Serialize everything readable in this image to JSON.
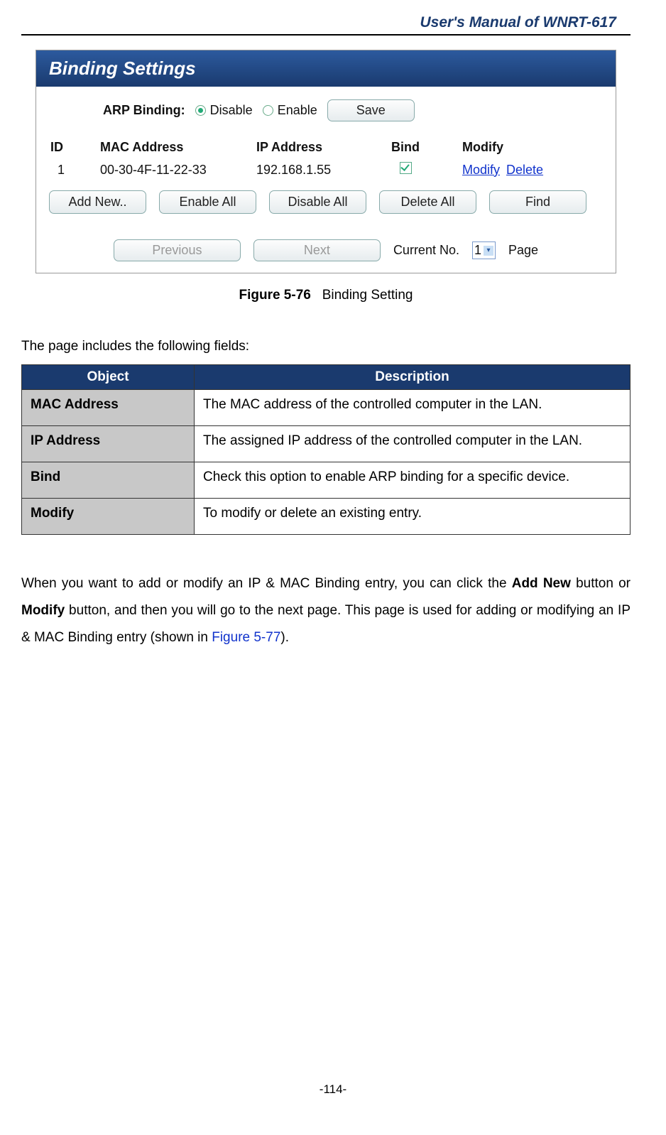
{
  "header": {
    "title": "User's  Manual  of  WNRT-617"
  },
  "screenshot": {
    "panel_title": "Binding Settings",
    "arp_label": "ARP Binding:",
    "radio_disable": "Disable",
    "radio_enable": "Enable",
    "save_btn": "Save",
    "cols": {
      "id": "ID",
      "mac": "MAC Address",
      "ip": "IP Address",
      "bind": "Bind",
      "modify": "Modify"
    },
    "row": {
      "id": "1",
      "mac": "00-30-4F-11-22-33",
      "ip": "192.168.1.55",
      "modify": "Modify",
      "delete": "Delete"
    },
    "btns": {
      "addnew": "Add New..",
      "enableall": "Enable All",
      "disableall": "Disable All",
      "deleteall": "Delete All",
      "find": "Find"
    },
    "pager": {
      "prev": "Previous",
      "next": "Next",
      "current_label": "Current No.",
      "current_val": "1",
      "page_label": "Page"
    }
  },
  "caption": {
    "bold": "Figure 5-76",
    "text": "Binding Setting"
  },
  "intro": "The page includes the following fields:",
  "table": {
    "h1": "Object",
    "h2": "Description",
    "rows": [
      {
        "obj": "MAC Address",
        "desc": "The MAC address of the controlled computer in the LAN."
      },
      {
        "obj": "IP Address",
        "desc": "The assigned IP address of the controlled computer in the LAN."
      },
      {
        "obj": "Bind",
        "desc": "Check this option to enable ARP binding for a specific device."
      },
      {
        "obj": "Modify",
        "desc": "To modify or delete an existing entry."
      }
    ]
  },
  "paragraph": {
    "p1": "When you want to add or modify an IP & MAC Binding entry, you can click the ",
    "b1": "Add New",
    "p2": " button or ",
    "b2": "Modify",
    "p3": " button, and then you will go to the next page. This page is used for adding or modifying an IP & MAC Binding entry (shown in ",
    "link": "Figure 5-77",
    "p4": ")."
  },
  "footer": "-114-"
}
